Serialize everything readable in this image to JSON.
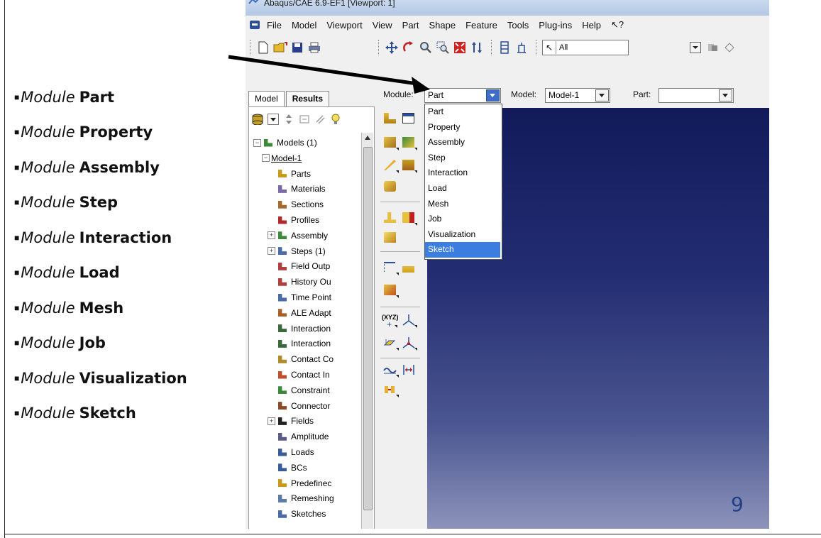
{
  "window": {
    "title": "Abaqus/CAE 6.9-EF1 [Viewport: 1]"
  },
  "menu": [
    "File",
    "Model",
    "Viewport",
    "View",
    "Part",
    "Shape",
    "Feature",
    "Tools",
    "Plug-ins",
    "Help",
    "↖?"
  ],
  "toolbar": {
    "selection_filter": "All"
  },
  "context_bar": {
    "module_label": "Module:",
    "module_value": "Part",
    "model_label": "Model:",
    "model_value": "Model-1",
    "part_label": "Part:",
    "part_value": ""
  },
  "tabs": [
    "Model",
    "Results"
  ],
  "tree": [
    {
      "label": "Models (1)",
      "depth": 0,
      "expander": "−",
      "icon": "models-icon",
      "color": "#3a8a3a"
    },
    {
      "label": "Model-1",
      "depth": 1,
      "expander": "−",
      "icon": "",
      "color": ""
    },
    {
      "label": "Parts",
      "depth": 2,
      "expander": "",
      "icon": "parts-icon",
      "color": "#c89a1a"
    },
    {
      "label": "Materials",
      "depth": 2,
      "expander": "",
      "icon": "materials-icon",
      "color": "#7b6aa8"
    },
    {
      "label": "Sections",
      "depth": 2,
      "expander": "",
      "icon": "sections-icon",
      "color": "#a86a2a"
    },
    {
      "label": "Profiles",
      "depth": 2,
      "expander": "",
      "icon": "profiles-icon",
      "color": "#b02a2a"
    },
    {
      "label": "Assembly",
      "depth": 2,
      "expander": "+",
      "icon": "assembly-icon",
      "color": "#3a8a3a"
    },
    {
      "label": "Steps (1)",
      "depth": 2,
      "expander": "+",
      "icon": "steps-icon",
      "color": "#4a6aa8"
    },
    {
      "label": "Field Outp",
      "depth": 2,
      "expander": "",
      "icon": "field-output-icon",
      "color": "#b04040"
    },
    {
      "label": "History Ou",
      "depth": 2,
      "expander": "",
      "icon": "history-output-icon",
      "color": "#b04040"
    },
    {
      "label": "Time Point",
      "depth": 2,
      "expander": "",
      "icon": "time-points-icon",
      "color": "#4a6aa8"
    },
    {
      "label": "ALE Adapt",
      "depth": 2,
      "expander": "",
      "icon": "ale-adaptive-icon",
      "color": "#a8602a"
    },
    {
      "label": "Interaction",
      "depth": 2,
      "expander": "",
      "icon": "interactions-icon",
      "color": "#3a6a3a"
    },
    {
      "label": "Interaction",
      "depth": 2,
      "expander": "",
      "icon": "interaction-properties-icon",
      "color": "#3a6a3a"
    },
    {
      "label": "Contact Co",
      "depth": 2,
      "expander": "",
      "icon": "contact-controls-icon",
      "color": "#b08a2a"
    },
    {
      "label": "Contact In",
      "depth": 2,
      "expander": "",
      "icon": "contact-initialization-icon",
      "color": "#c0502a"
    },
    {
      "label": "Constraint",
      "depth": 2,
      "expander": "",
      "icon": "constraints-icon",
      "color": "#3a8a3a"
    },
    {
      "label": "Connector",
      "depth": 2,
      "expander": "",
      "icon": "connector-icon",
      "color": "#8a4a2a"
    },
    {
      "label": "Fields",
      "depth": 2,
      "expander": "+",
      "icon": "fields-icon",
      "color": "#222222"
    },
    {
      "label": "Amplitude",
      "depth": 2,
      "expander": "",
      "icon": "amplitudes-icon",
      "color": "#5a5a8a"
    },
    {
      "label": "Loads",
      "depth": 2,
      "expander": "",
      "icon": "loads-icon",
      "color": "#3a5a9a"
    },
    {
      "label": "BCs",
      "depth": 2,
      "expander": "",
      "icon": "bcs-icon",
      "color": "#3a5a9a"
    },
    {
      "label": "Predefinec",
      "depth": 2,
      "expander": "",
      "icon": "predefined-fields-icon",
      "color": "#c89a1a"
    },
    {
      "label": "Remeshing",
      "depth": 2,
      "expander": "",
      "icon": "remeshing-icon",
      "color": "#5a7aa8"
    },
    {
      "label": "Sketches",
      "depth": 2,
      "expander": "",
      "icon": "sketches-icon",
      "color": "#4a6aa8"
    }
  ],
  "module_options": [
    "Part",
    "Property",
    "Assembly",
    "Step",
    "Interaction",
    "Load",
    "Mesh",
    "Job",
    "Visualization",
    "Sketch"
  ],
  "highlighted_option": "Sketch",
  "module_list": {
    "prefix": "Module",
    "items": [
      "Part",
      "Property",
      "Assembly",
      "Step",
      "Interaction",
      "Load",
      "Mesh",
      "Job",
      "Visualization",
      "Sketch"
    ]
  },
  "slide_number": "9",
  "colors": {
    "viewport_top": "#121a5a",
    "viewport_bottom": "#8d93ba",
    "highlight": "#3b7ee0",
    "slide_number": "#1f3f88"
  }
}
